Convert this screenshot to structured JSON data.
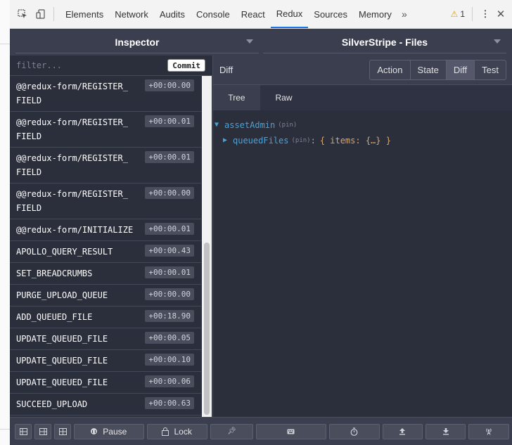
{
  "devtools": {
    "tabs": [
      "Elements",
      "Network",
      "Audits",
      "Console",
      "React",
      "Redux",
      "Sources",
      "Memory"
    ],
    "active_tab": "Redux",
    "more_label": "»",
    "warnings_count": "1"
  },
  "topbar": {
    "monitor_select": "Inspector",
    "store_select": "SilverStripe - Files"
  },
  "left": {
    "filter_placeholder": "filter...",
    "commit_label": "Commit",
    "actions": [
      {
        "name": "@@redux-form/REGISTER_FIELD",
        "time": "+00:00.00"
      },
      {
        "name": "@@redux-form/REGISTER_FIELD",
        "time": "+00:00.01"
      },
      {
        "name": "@@redux-form/REGISTER_FIELD",
        "time": "+00:00.01"
      },
      {
        "name": "@@redux-form/REGISTER_FIELD",
        "time": "+00:00.00"
      },
      {
        "name": "@@redux-form/INITIALIZE",
        "time": "+00:00.01"
      },
      {
        "name": "APOLLO_QUERY_RESULT",
        "time": "+00:00.43"
      },
      {
        "name": "SET_BREADCRUMBS",
        "time": "+00:00.01"
      },
      {
        "name": "PURGE_UPLOAD_QUEUE",
        "time": "+00:00.00"
      },
      {
        "name": "ADD_QUEUED_FILE",
        "time": "+00:18.90"
      },
      {
        "name": "UPDATE_QUEUED_FILE",
        "time": "+00:00.05"
      },
      {
        "name": "UPDATE_QUEUED_FILE",
        "time": "+00:00.10"
      },
      {
        "name": "UPDATE_QUEUED_FILE",
        "time": "+00:00.06"
      },
      {
        "name": "SUCCEED_UPLOAD",
        "time": "+00:00.63"
      }
    ]
  },
  "right": {
    "title": "Diff",
    "tabs": [
      "Action",
      "State",
      "Diff",
      "Test"
    ],
    "active_tab": "Diff",
    "subtabs": [
      "Tree",
      "Raw"
    ],
    "active_subtab": "Tree",
    "tree": {
      "root_key": "assetAdmin",
      "root_pin": "(pin)",
      "child_key": "queuedFiles",
      "child_pin": "(pin)",
      "child_value": "{ items: {…} }"
    }
  },
  "bottombar": {
    "pause_label": "Pause",
    "lock_label": "Lock"
  }
}
